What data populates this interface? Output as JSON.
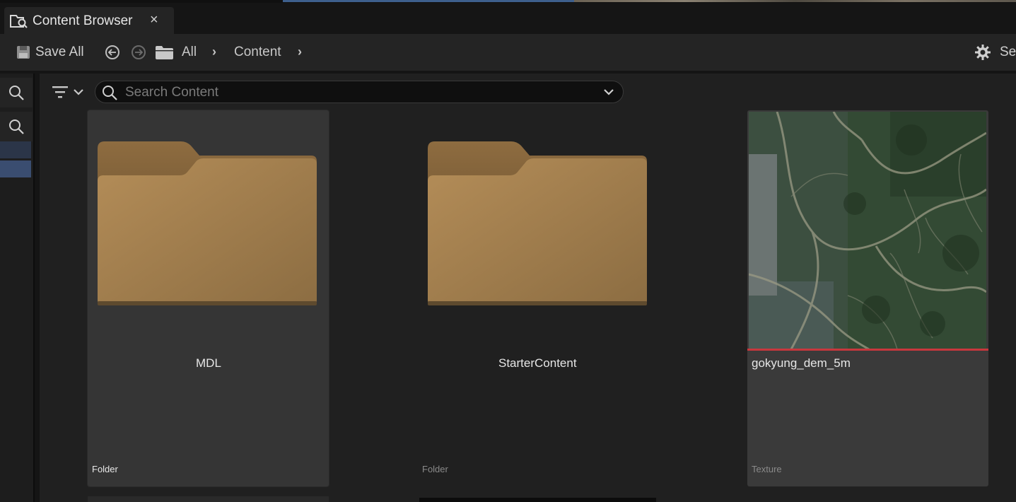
{
  "tab": {
    "title": "Content Browser",
    "close_glyph": "×",
    "icon": "content-browser-icon"
  },
  "toolbar": {
    "save_all_label": "Save All",
    "save_icon": "save-icon",
    "back_icon": "arrow-left-circle-icon",
    "forward_icon": "arrow-right-circle-icon",
    "breadcrumbs": [
      "All",
      "Content"
    ],
    "chevron": "›",
    "settings_label": "Se"
  },
  "search": {
    "placeholder": "Search Content",
    "value": ""
  },
  "assets": [
    {
      "name": "MDL",
      "type": "Folder",
      "selected": true
    },
    {
      "name": "StarterContent",
      "type": "Folder",
      "selected": false
    },
    {
      "name": "gokyung_dem_5m",
      "type": "Texture",
      "selected": false
    }
  ],
  "colors": {
    "folder": "#a98552",
    "texture_underline": "#c8373d",
    "selection": "#3a4d70"
  }
}
